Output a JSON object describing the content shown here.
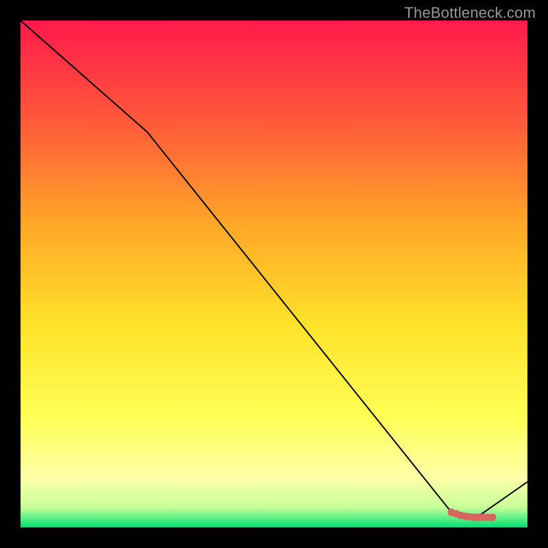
{
  "attribution": "TheBottleneck.com",
  "colors": {
    "gradient_top": "#ff1a4b",
    "gradient_20": "#ff5a3a",
    "gradient_40": "#ffa628",
    "gradient_60": "#ffe22a",
    "gradient_78": "#ffff55",
    "gradient_90": "#ffffa8",
    "gradient_96": "#c8ff9a",
    "gradient_bottom": "#00e070",
    "line": "#000000",
    "marker": "#d6665f"
  },
  "chart_data": {
    "type": "line",
    "x": [
      0,
      25,
      85,
      88,
      90,
      100
    ],
    "y": [
      100,
      78,
      3,
      2,
      2,
      9
    ],
    "xlim": [
      0,
      100
    ],
    "ylim": [
      0,
      100
    ],
    "title": "",
    "xlabel": "",
    "ylabel": "",
    "markers": {
      "x": [
        85.0,
        85.9,
        86.8,
        87.7,
        88.6,
        89.5,
        90.4,
        91.3,
        92.2,
        93.1
      ],
      "y": [
        3.0,
        2.7,
        2.4,
        2.2,
        2.1,
        2.0,
        2.0,
        2.0,
        2.0,
        2.0
      ]
    }
  }
}
